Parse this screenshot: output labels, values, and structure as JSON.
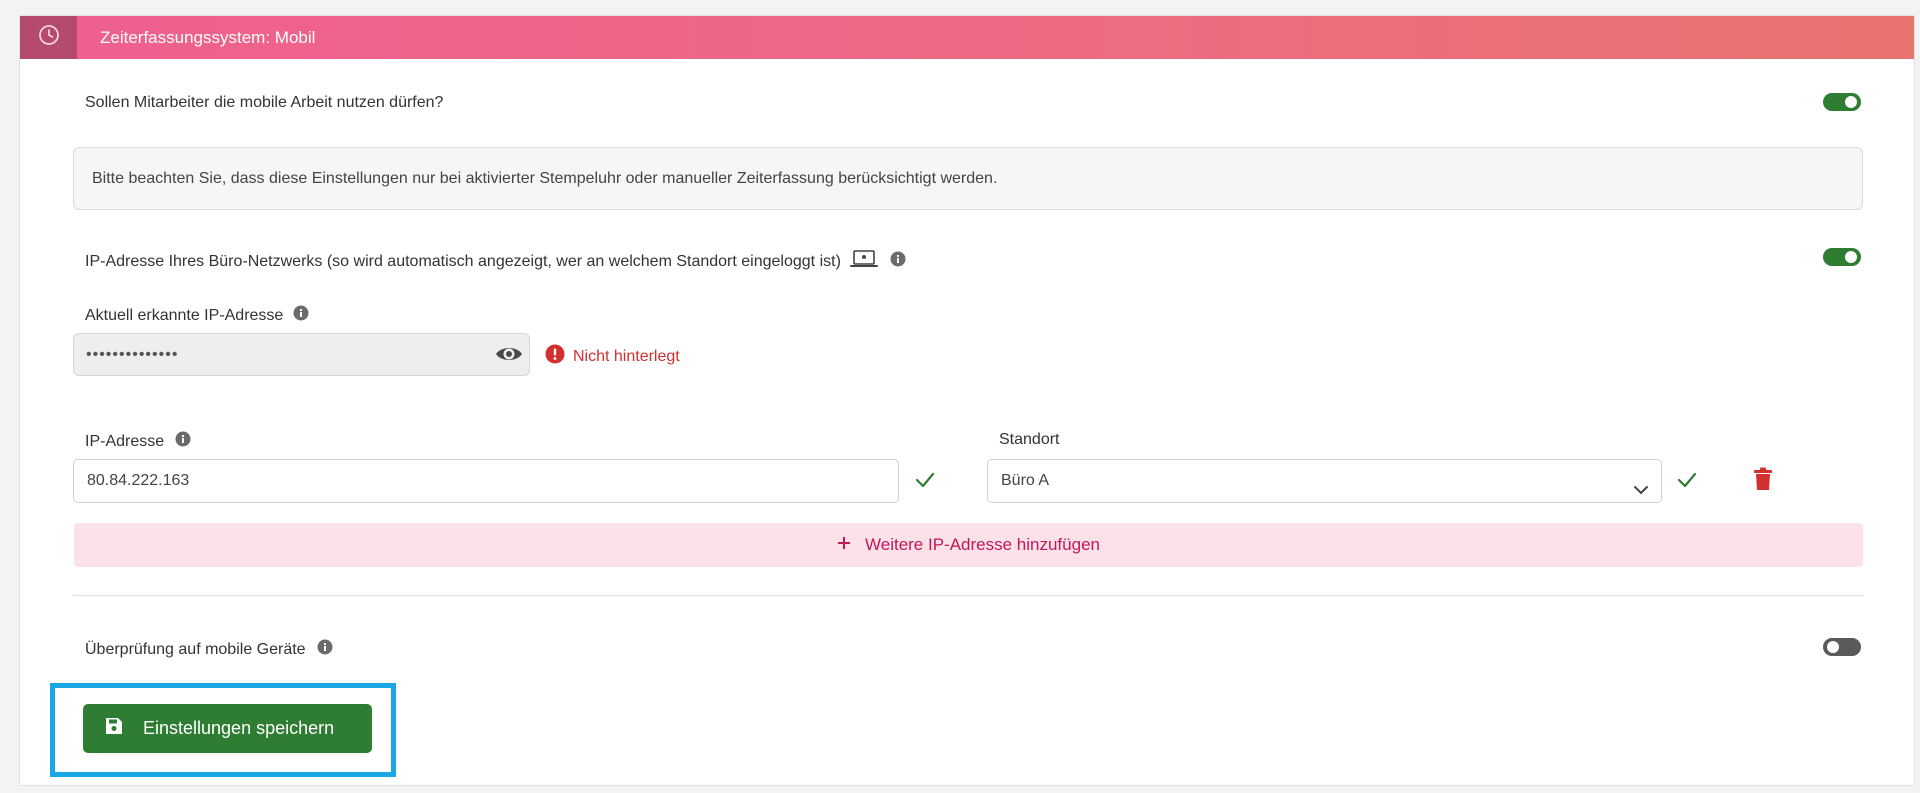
{
  "header": {
    "title": "Zeiterfassungssystem: Mobil",
    "icon": "clock-icon",
    "gradient": [
      "#ee5f8f",
      "#e8736f"
    ]
  },
  "mobile_work": {
    "question": "Sollen Mitarbeiter die mobile Arbeit nutzen dürfen?",
    "enabled": true
  },
  "notice": {
    "text": "Bitte beachten Sie, dass diese Einstellungen nur bei aktivierter Stempeluhr oder manueller Zeiterfassung berücksichtigt werden."
  },
  "office_network": {
    "label": "IP-Adresse Ihres Büro-Netzwerks (so wird automatisch angezeigt, wer an welchem Standort eingeloggt ist)",
    "enabled": true
  },
  "detected_ip": {
    "label": "Aktuell erkannte IP-Adresse",
    "masked_value": "••••••••••••••",
    "status": "Nicht hinterlegt"
  },
  "entries": {
    "ip_label": "IP-Adresse",
    "location_label": "Standort",
    "rows": [
      {
        "ip": "80.84.222.163",
        "location": "Büro A"
      }
    ],
    "add_label": "Weitere IP-Adresse hinzufügen"
  },
  "mobile_check": {
    "label": "Überprüfung auf mobile Geräte",
    "enabled": false
  },
  "save_button": {
    "label": "Einstellungen speichern"
  },
  "colors": {
    "toggle_on": "#2e7d32",
    "toggle_off": "#5a5a5a",
    "error": "#d32f2f",
    "accent": "#c2185b",
    "highlight": "#1aa7e6"
  }
}
